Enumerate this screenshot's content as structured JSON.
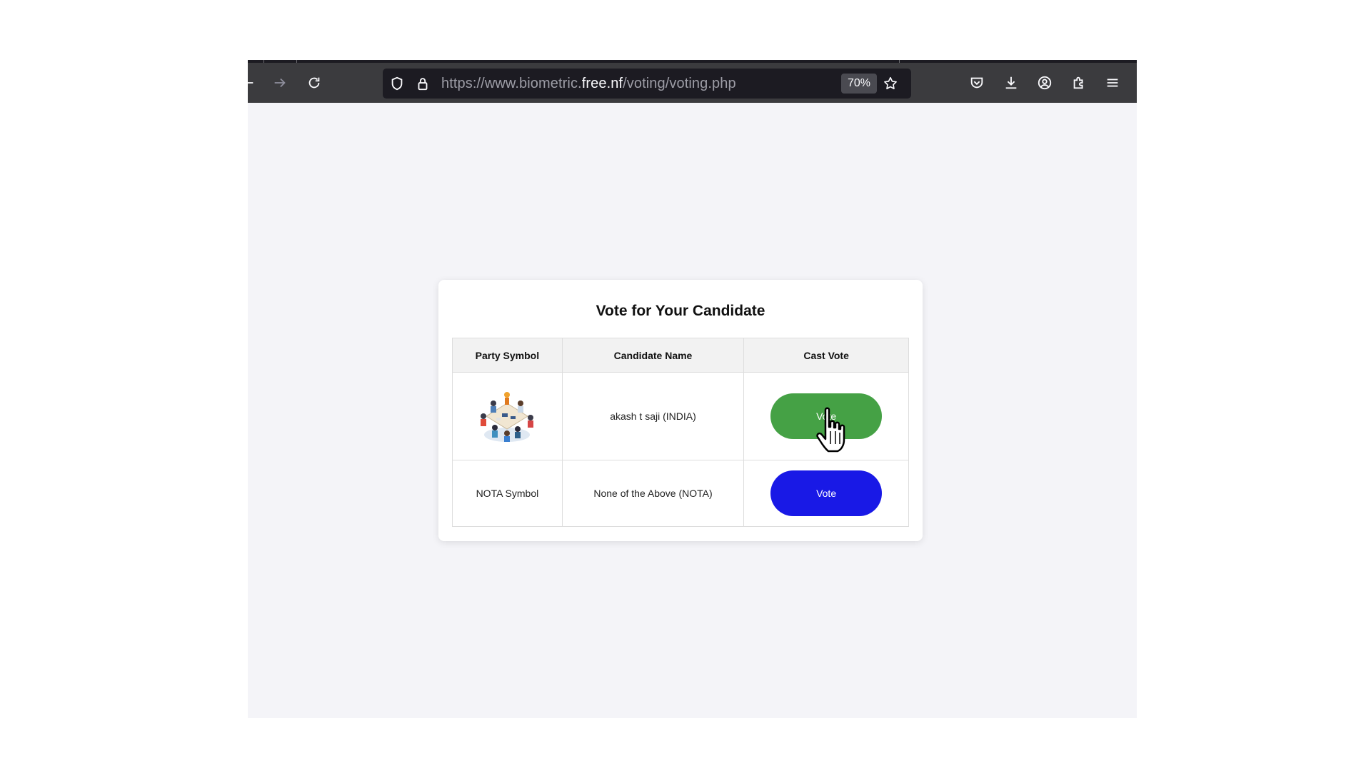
{
  "browser": {
    "url_prefix": "https://www.biometric.",
    "url_host": "free.nf",
    "url_path": "/voting/voting.php",
    "zoom": "70%"
  },
  "page": {
    "title": "Vote for Your Candidate",
    "table": {
      "headers": [
        "Party Symbol",
        "Candidate Name",
        "Cast Vote"
      ],
      "rows": [
        {
          "symbol": "party-symbol-image",
          "candidate": "akash t saji (INDIA)",
          "vote_label": "Vote",
          "button_color": "#45a145"
        },
        {
          "symbol": "NOTA Symbol",
          "candidate": "None of the Above (NOTA)",
          "vote_label": "Vote",
          "button_color": "#1919e6"
        }
      ]
    }
  },
  "colors": {
    "toolbar_bg": "#3b3b3e",
    "urlbar_bg": "#1c1b22",
    "page_bg": "#f4f4f8",
    "vote_green": "#45a145",
    "vote_blue": "#1919e6"
  }
}
